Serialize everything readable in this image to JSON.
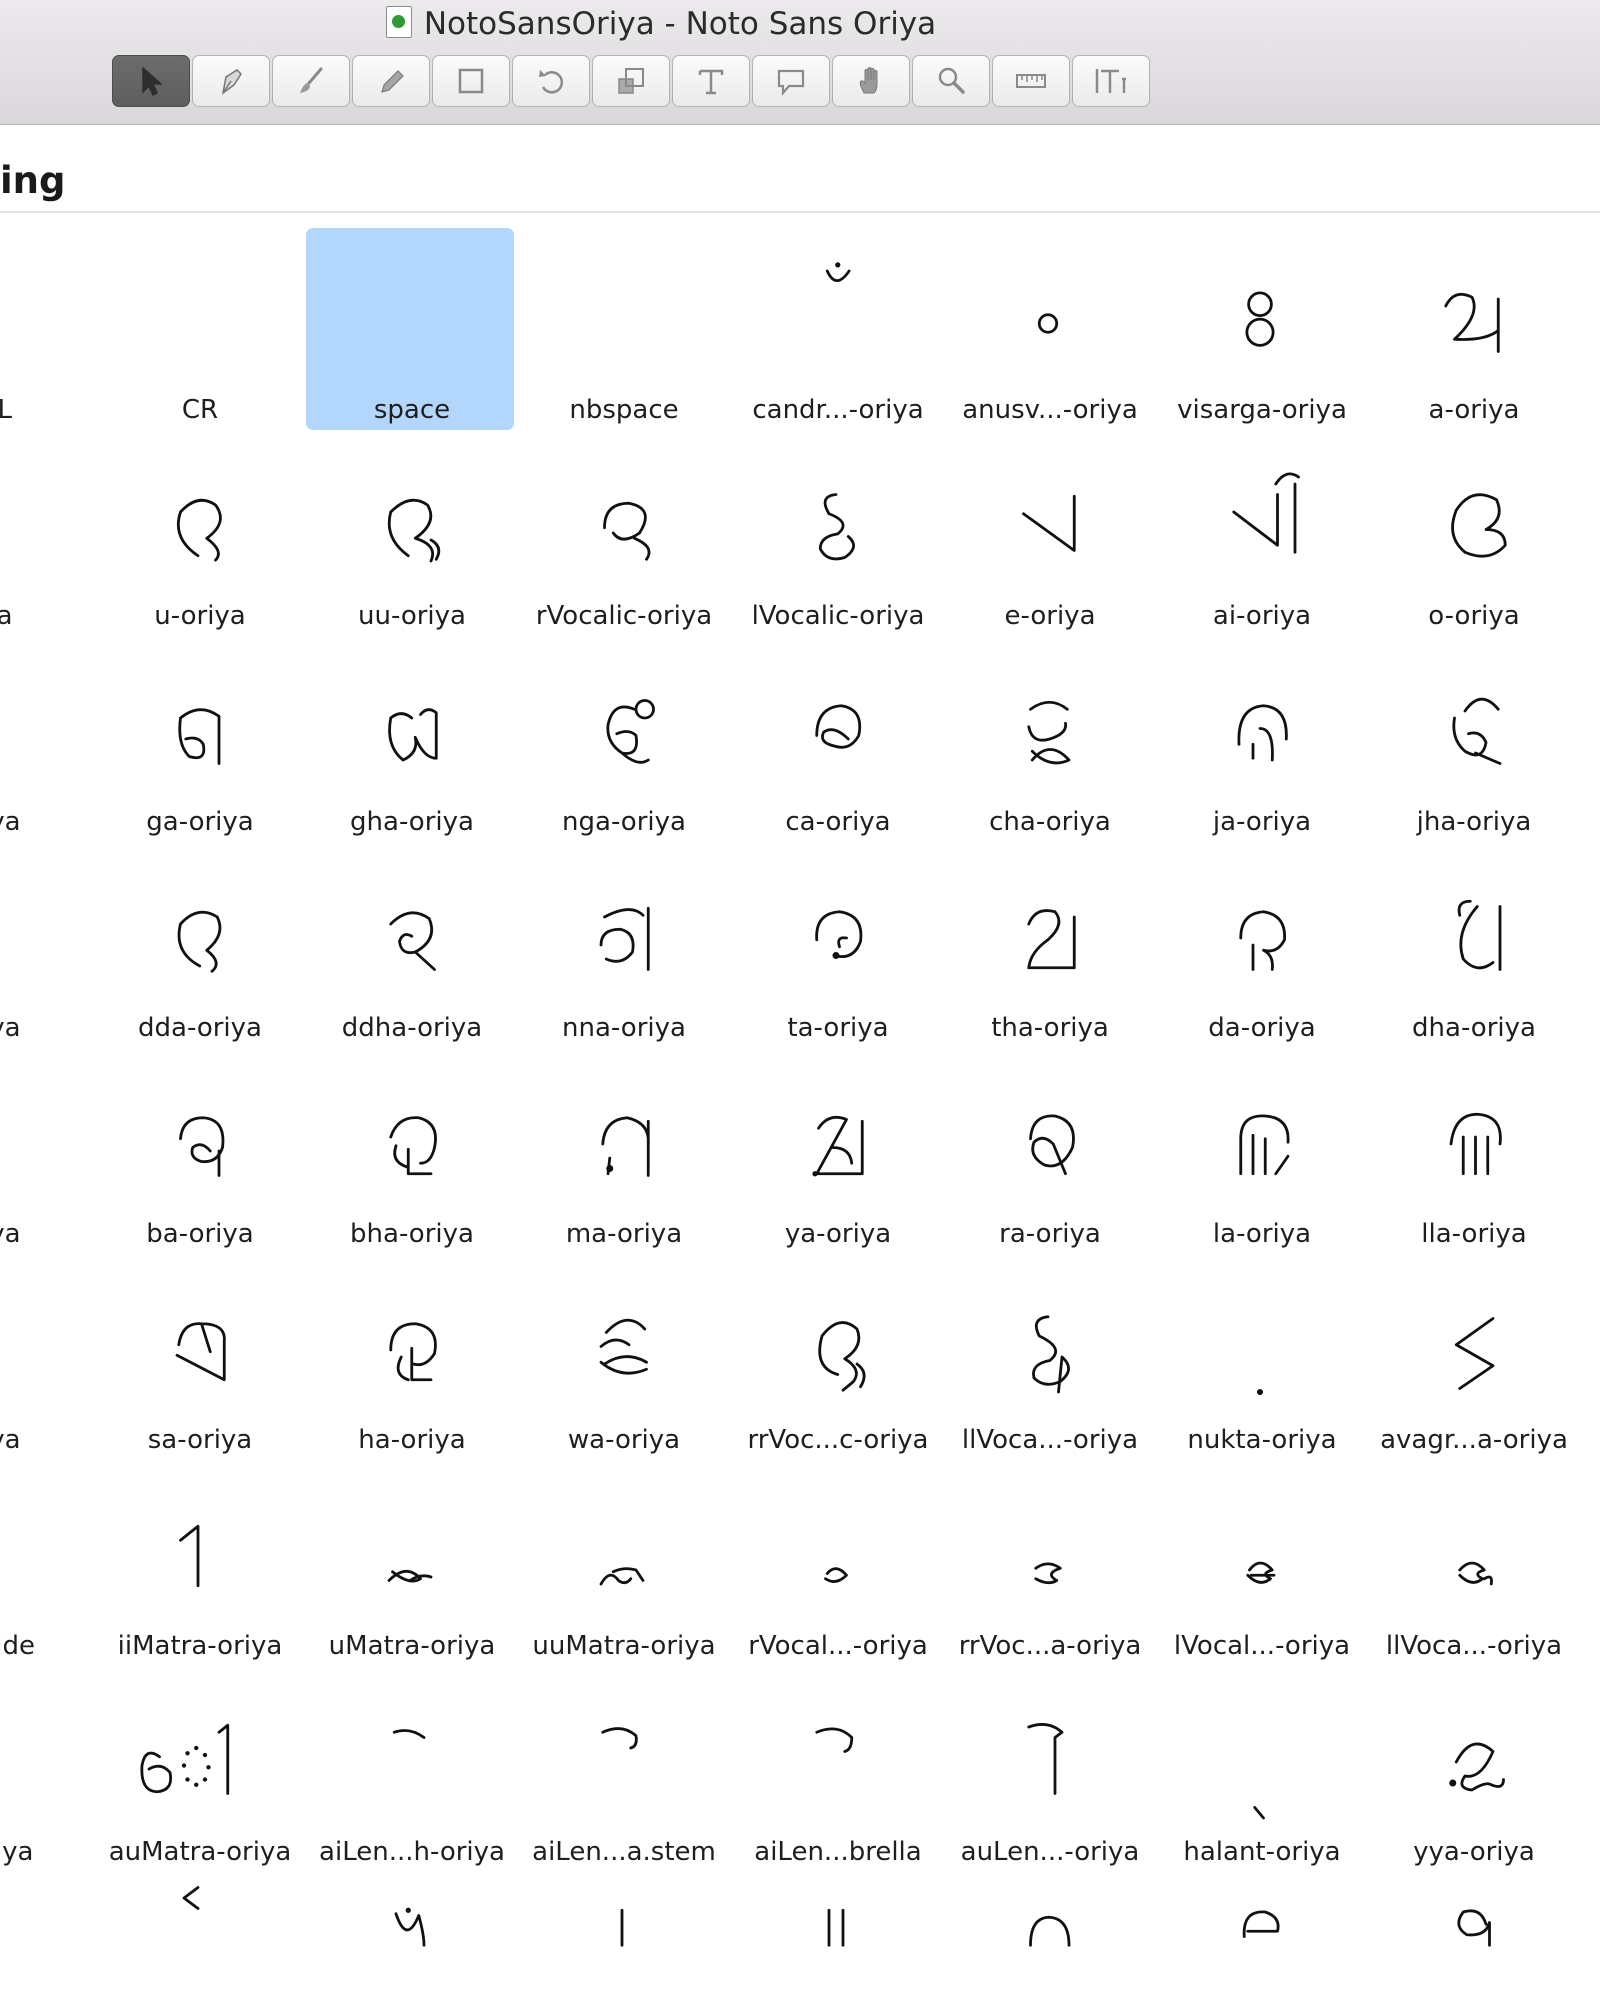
{
  "window": {
    "title": "NotoSansOriya - Noto Sans Oriya"
  },
  "toolbar": {
    "tools": [
      {
        "name": "pointer-tool",
        "icon": "pointer-icon",
        "active": true
      },
      {
        "name": "pen-tool",
        "icon": "pen-icon"
      },
      {
        "name": "brush-tool",
        "icon": "brush-icon"
      },
      {
        "name": "pencil-tool",
        "icon": "pencil-icon"
      },
      {
        "name": "rectangle-tool",
        "icon": "rectangle-icon"
      },
      {
        "name": "rotate-tool",
        "icon": "rotate-icon"
      },
      {
        "name": "scale-tool",
        "icon": "scale-icon"
      },
      {
        "name": "text-tool",
        "icon": "text-icon"
      },
      {
        "name": "annotation-tool",
        "icon": "speech-bubble-icon"
      },
      {
        "name": "hand-tool",
        "icon": "hand-icon"
      },
      {
        "name": "zoom-tool",
        "icon": "magnifier-icon"
      },
      {
        "name": "measure-tool",
        "icon": "ruler-icon"
      },
      {
        "name": "metrics-tool",
        "icon": "text-metrics-icon"
      }
    ]
  },
  "section": {
    "title": "ing"
  },
  "glyphs": [
    [
      "ULL",
      "CR",
      "space",
      "nbspace",
      "candr...-oriya",
      "anusv...-oriya",
      "visarga-oriya",
      "a-oriya"
    ],
    [
      "riya",
      "u-oriya",
      "uu-oriya",
      "rVocalic-oriya",
      "lVocalic-oriya",
      "e-oriya",
      "ai-oriya",
      "o-oriya"
    ],
    [
      "oriya",
      "ga-oriya",
      "gha-oriya",
      "nga-oriya",
      "ca-oriya",
      "cha-oriya",
      "ja-oriya",
      "jha-oriya"
    ],
    [
      "oriya",
      "dda-oriya",
      "ddha-oriya",
      "nna-oriya",
      "ta-oriya",
      "tha-oriya",
      "da-oriya",
      "dha-oriya"
    ],
    [
      "oriya",
      "ba-oriya",
      "bha-oriya",
      "ma-oriya",
      "ya-oriya",
      "ra-oriya",
      "la-oriya",
      "lla-oriya"
    ],
    [
      "oriya",
      "sa-oriya",
      "ha-oriya",
      "wa-oriya",
      "rrVoc...c-oriya",
      "llVoca...-oriya",
      "nukta-oriya",
      "avagr...a-oriya"
    ],
    [
      "....wide",
      "iiMatra-oriya",
      "uMatra-oriya",
      "uuMatra-oriya",
      "rVocal...-oriya",
      "rrVoc...a-oriya",
      "lVocal...-oriya",
      "llVoca...-oriya"
    ],
    [
      "a-oriya",
      "auMatra-oriya",
      "aiLen...h-oriya",
      "aiLen...a.stem",
      "aiLen...brella",
      "auLen...-oriya",
      "halant-oriya",
      "yya-oriya"
    ],
    [
      "",
      "",
      "",
      "",
      "",
      "",
      "",
      ""
    ]
  ],
  "selected": "space"
}
